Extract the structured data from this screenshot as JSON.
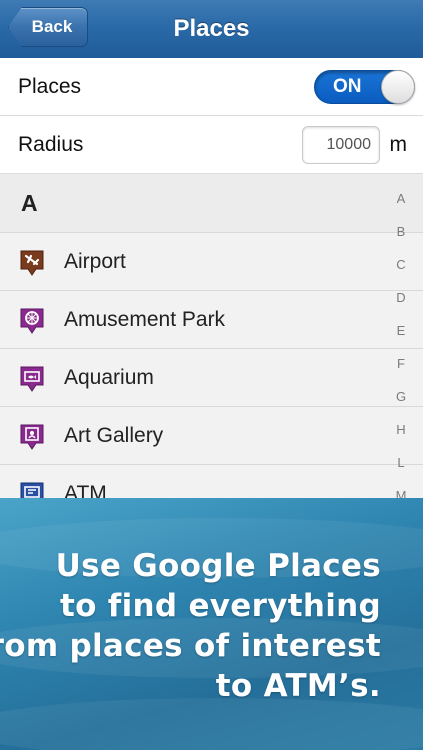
{
  "nav": {
    "back_label": "Back",
    "title": "Places"
  },
  "settings": {
    "places_label": "Places",
    "toggle_state": "ON",
    "radius_label": "Radius",
    "radius_value": "10000",
    "radius_unit": "m"
  },
  "list": {
    "section": "A",
    "items": [
      {
        "label": "Airport",
        "icon": "airport-icon",
        "color": "#7a3b1d"
      },
      {
        "label": "Amusement Park",
        "icon": "amusement-park-icon",
        "color": "#8a2a8f"
      },
      {
        "label": "Aquarium",
        "icon": "aquarium-icon",
        "color": "#8a2a8f"
      },
      {
        "label": "Art Gallery",
        "icon": "art-gallery-icon",
        "color": "#8a2a8f"
      },
      {
        "label": "ATM",
        "icon": "atm-icon",
        "color": "#2a4fa3"
      }
    ],
    "index": [
      "A",
      "B",
      "C",
      "D",
      "E",
      "F",
      "G",
      "H",
      "L",
      "M"
    ]
  },
  "promo": {
    "lines": [
      "Use Google Places",
      "to find everything",
      "from places of interest",
      "to ATM’s."
    ]
  },
  "colors": {
    "nav_blue": "#2a6aa8",
    "toggle_blue": "#0a5cc0",
    "promo_blue": "#2f86b1"
  }
}
